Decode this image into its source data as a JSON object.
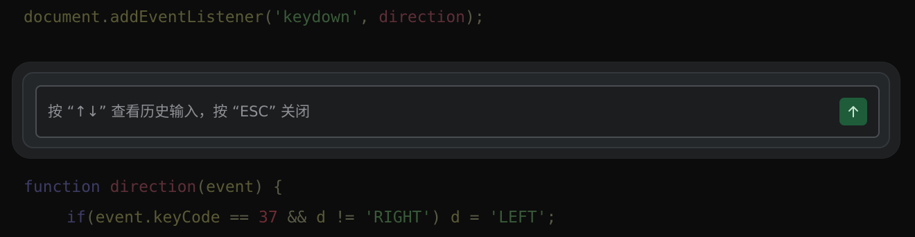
{
  "background_code": {
    "line1": {
      "obj": "document",
      "dot": ".",
      "method": "addEventListener",
      "open": "(",
      "arg1": "'keydown'",
      "comma": ", ",
      "arg2": "direction",
      "close": ");"
    },
    "line2": {
      "keyword": "function",
      "space": " ",
      "name": "direction",
      "open": "(",
      "param": "event",
      "close": ") {"
    },
    "line3": {
      "keyword": "if",
      "open": "(",
      "lhs": "event.keyCode",
      "eq": " == ",
      "num": "37",
      "and": " && ",
      "var": "d",
      "neq": " != ",
      "str1": "'RIGHT'",
      "close": ") ",
      "var2": "d",
      "assign": " = ",
      "str2": "'LEFT'",
      "semi": ";"
    }
  },
  "chat_input": {
    "placeholder": "按 “↑↓” 查看历史输入，按 “ESC” 关闭",
    "value": ""
  },
  "send_button": {
    "icon": "arrow-up-icon",
    "color": "#1f5c3a"
  }
}
